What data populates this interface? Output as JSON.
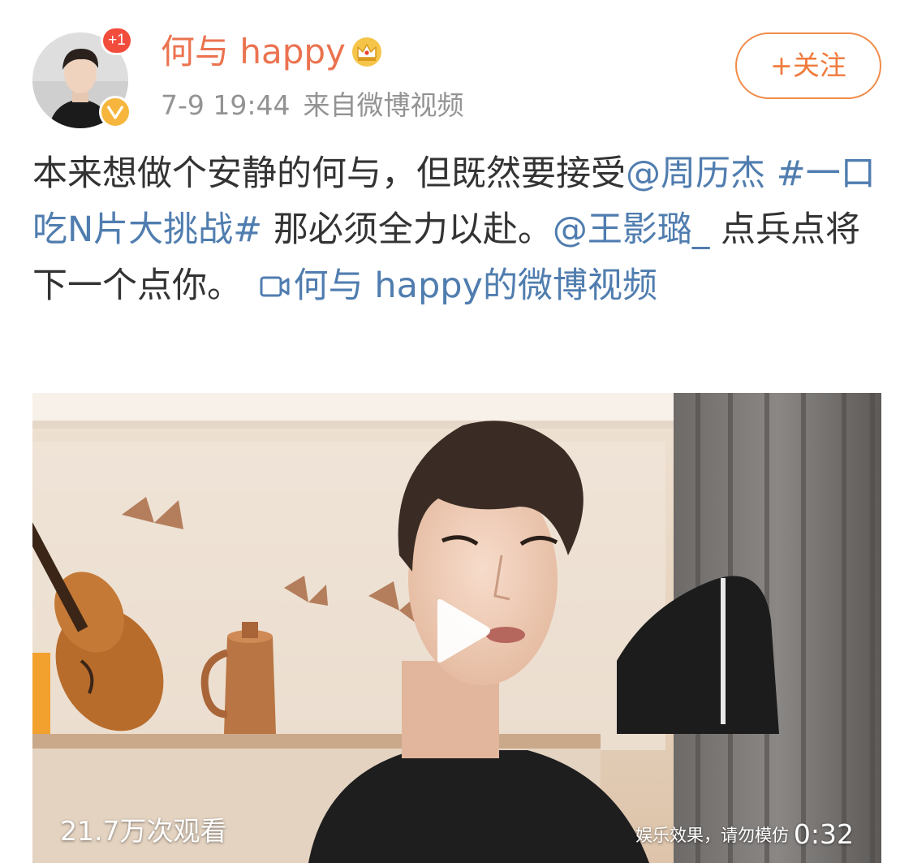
{
  "author": {
    "name": "何与 happy",
    "notification_count": "+1",
    "avatar": "avatar-photo",
    "verified_icon": "verified-v-icon",
    "membership_icon": "crown-icon"
  },
  "post_meta": {
    "time": "7-9 19:44",
    "source": "来自微博视频"
  },
  "follow_button": {
    "label": "+关注"
  },
  "post": {
    "text_1": "本来想做个安静的何与，但既然要接受",
    "mention_1": "@周历杰",
    "hashtag": "#一口吃N片大挑战#",
    "text_2": " 那必须全力以赴。",
    "mention_2": "@王影璐_",
    "text_3": " 点兵点将下一个点你。 ",
    "video_link": "何与 happy的微博视频",
    "video_link_icon": "video-camera-icon"
  },
  "video": {
    "views": "21.7万次观看",
    "disclaimer": "娱乐效果，请勿模仿",
    "duration": "0:32",
    "play_icon": "play-icon"
  },
  "colors": {
    "name": "#eb7350",
    "link": "#507daf",
    "meta": "#939393",
    "follow": "#f07a3b",
    "text": "#333333"
  }
}
